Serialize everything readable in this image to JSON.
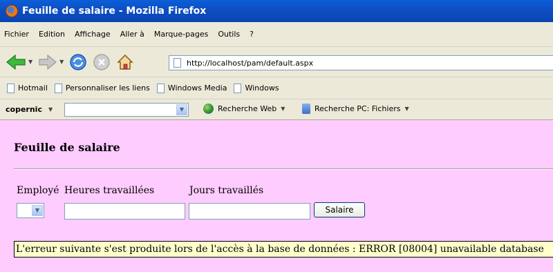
{
  "window": {
    "title": "Feuille de salaire - Mozilla Firefox"
  },
  "menu": {
    "items": [
      "Fichier",
      "Edition",
      "Affichage",
      "Aller à",
      "Marque-pages",
      "Outils",
      "?"
    ]
  },
  "navigation": {
    "url": "http://localhost/pam/default.aspx"
  },
  "bookmarks": {
    "items": [
      "Hotmail",
      "Personnaliser les liens",
      "Windows Media",
      "Windows"
    ]
  },
  "copernic": {
    "logo": "copernic",
    "search_web": "Recherche Web",
    "search_pc": "Recherche PC: Fichiers"
  },
  "page": {
    "title": "Feuille de salaire",
    "labels": {
      "employee": "Employé",
      "hours": "Heures travaillées",
      "days": "Jours travaillés"
    },
    "inputs": {
      "hours_value": "",
      "days_value": ""
    },
    "button_label": "Salaire",
    "error_message": "L'erreur suivante s'est produite lors de l'accès à la base de données : ERROR [08004] unavailable database"
  }
}
